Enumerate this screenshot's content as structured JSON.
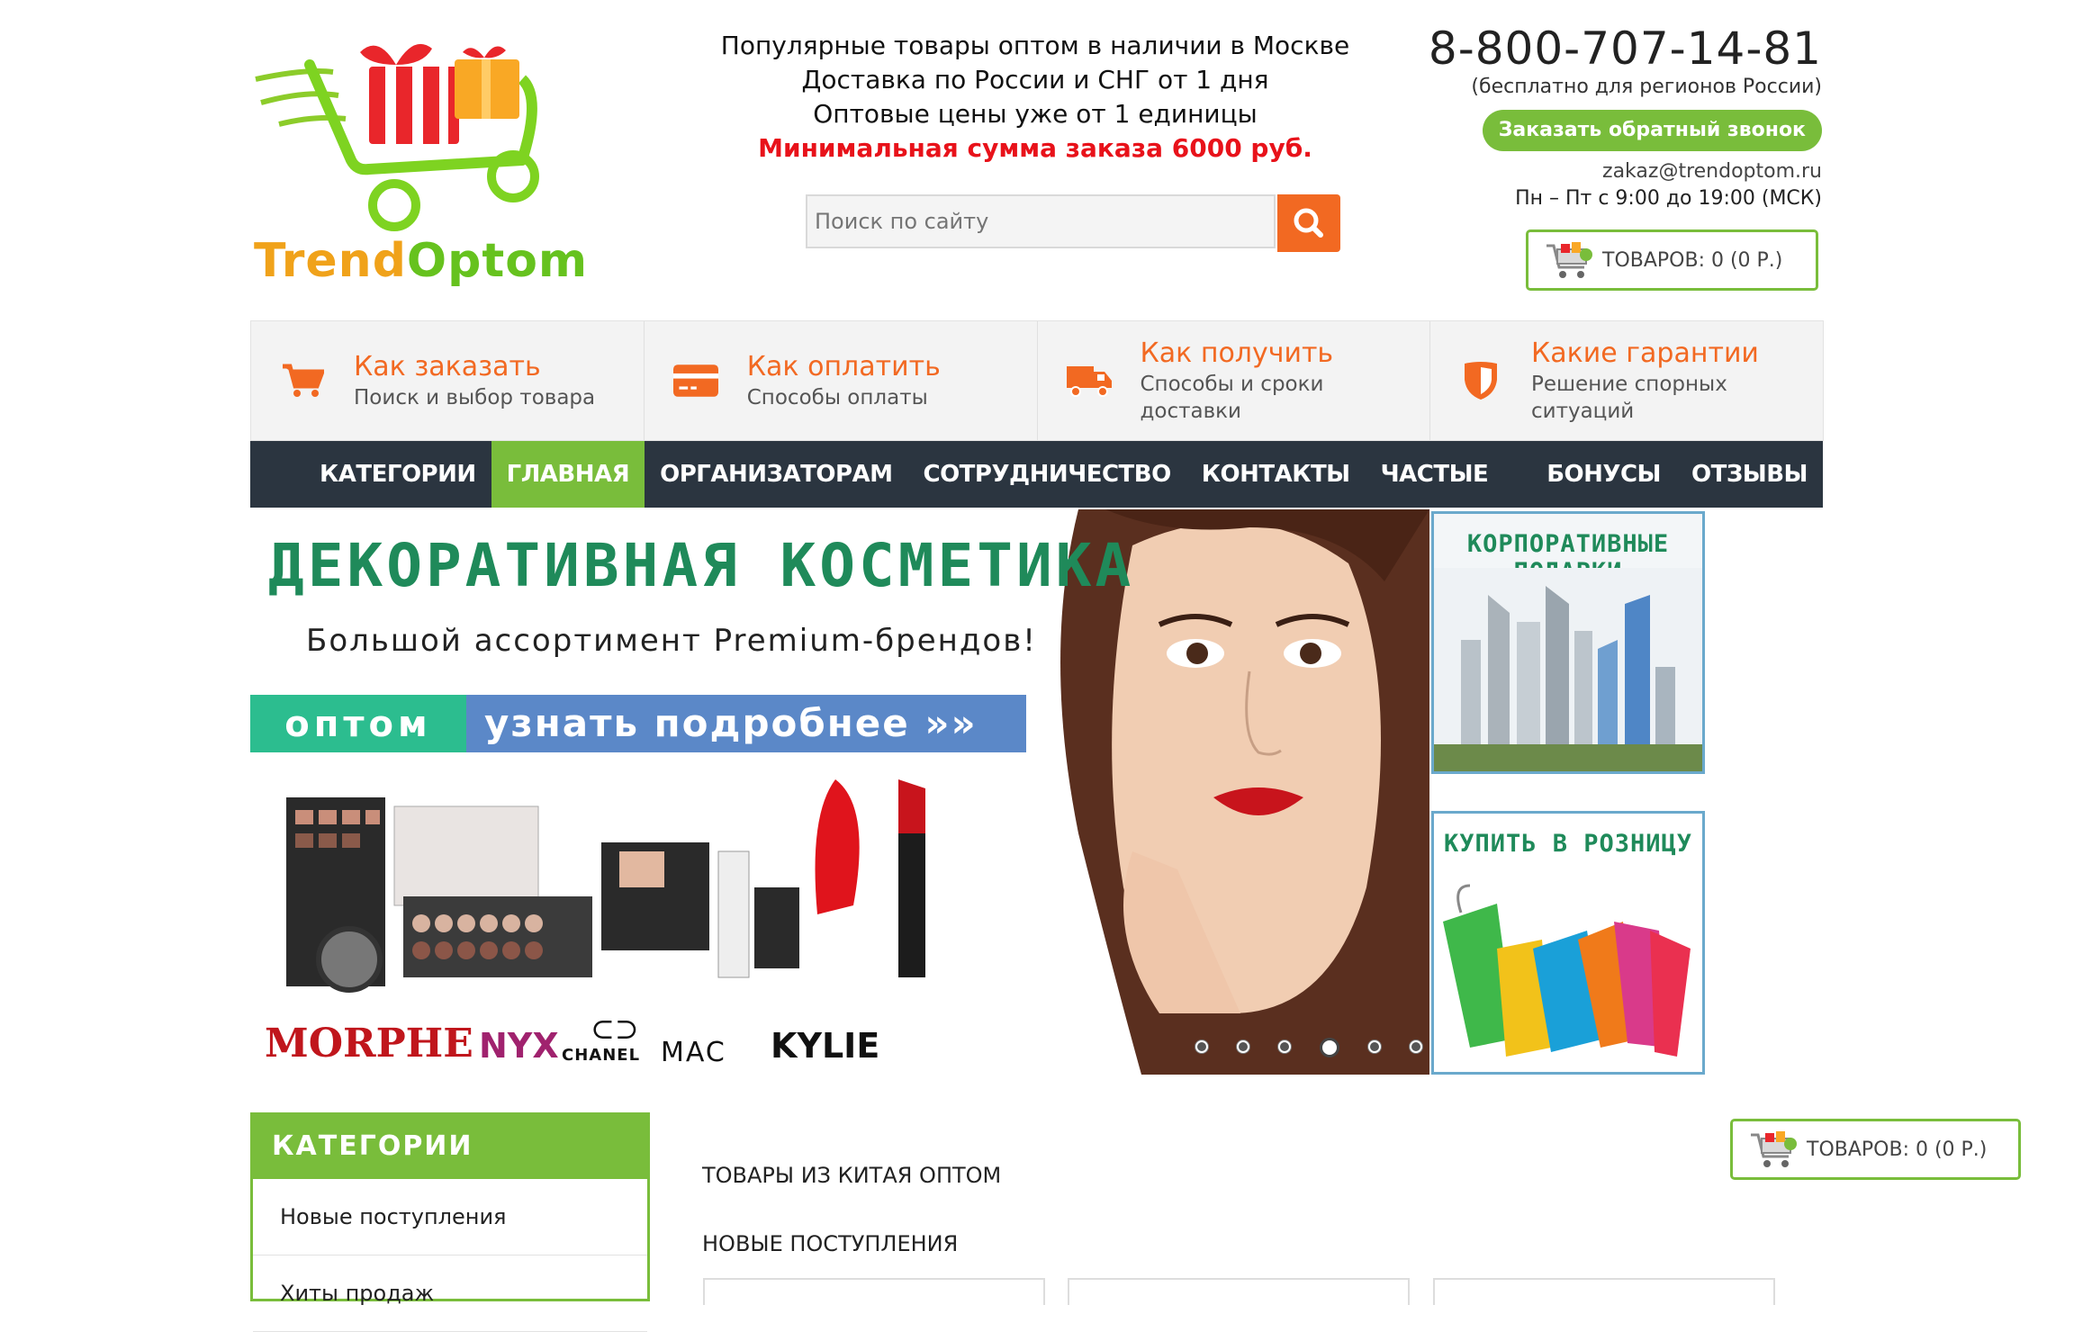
{
  "logo": {
    "text_part1": "Trend",
    "text_part2": "Optom"
  },
  "promo": {
    "line1": "Популярные товары оптом в наличии в Москве",
    "line2": "Доставка по России и СНГ от 1 дня",
    "line3": "Оптовые цены уже от 1 единицы",
    "line4": "Минимальная сумма заказа 6000 руб."
  },
  "search": {
    "placeholder": "Поиск по сайту"
  },
  "contacts": {
    "phone": "8-800-707-14-81",
    "phone_note": "(бесплатно для регионов России)",
    "callback_label": "Заказать обратный звонок",
    "email": "zakaz@trendoptom.ru",
    "hours": "Пн – Пт с 9:00 до 19:00 (МСК)"
  },
  "cart": {
    "label": "ТОВАРОВ: 0 (0 Р.)"
  },
  "info_items": [
    {
      "title": "Как заказать",
      "subtitle": "Поиск и выбор товара",
      "icon": "cart-icon"
    },
    {
      "title": "Как оплатить",
      "subtitle": "Способы оплаты",
      "icon": "credit-card-icon"
    },
    {
      "title": "Как получить",
      "subtitle": "Способы и сроки доставки",
      "icon": "truck-icon"
    },
    {
      "title": "Какие гарантии",
      "subtitle": "Решение спорных ситуаций",
      "icon": "shield-icon"
    }
  ],
  "nav": {
    "items": [
      "КАТЕГОРИИ",
      "ГЛАВНАЯ",
      "ОРГАНИЗАТОРАМ СП",
      "СОТРУДНИЧЕСТВО",
      "КОНТАКТЫ",
      "ЧАСТЫЕ ВОПРОСЫ",
      "БОНУСЫ",
      "ОТЗЫВЫ"
    ],
    "active": "ГЛАВНАЯ"
  },
  "banner": {
    "title": "ДЕКОРАТИВНАЯ КОСМЕТИКА",
    "subtitle": "Большой ассортимент Premium-брендов!",
    "tag": "оптом",
    "cta": "узнать подробнее »»",
    "brands": [
      "MORPHE",
      "NYX",
      "CHANEL",
      "MAC",
      "KYLIE"
    ],
    "slides_total": 6,
    "active_slide": 4
  },
  "side_ads": [
    {
      "title": "КОРПОРАТИВНЫЕ ПОДАРКИ"
    },
    {
      "title": "КУПИТЬ В РОЗНИЦУ"
    }
  ],
  "categories": {
    "heading": "КАТЕГОРИИ",
    "items": [
      "Новые поступления",
      "Хиты продаж"
    ]
  },
  "main": {
    "heading1": "ТОВАРЫ ИЗ КИТАЯ ОПТОМ",
    "heading2": "НОВЫЕ ПОСТУПЛЕНИЯ"
  },
  "colors": {
    "green": "#79bd3b",
    "orange": "#f26922",
    "dark_nav": "#2b3540",
    "red": "#e8121a"
  }
}
